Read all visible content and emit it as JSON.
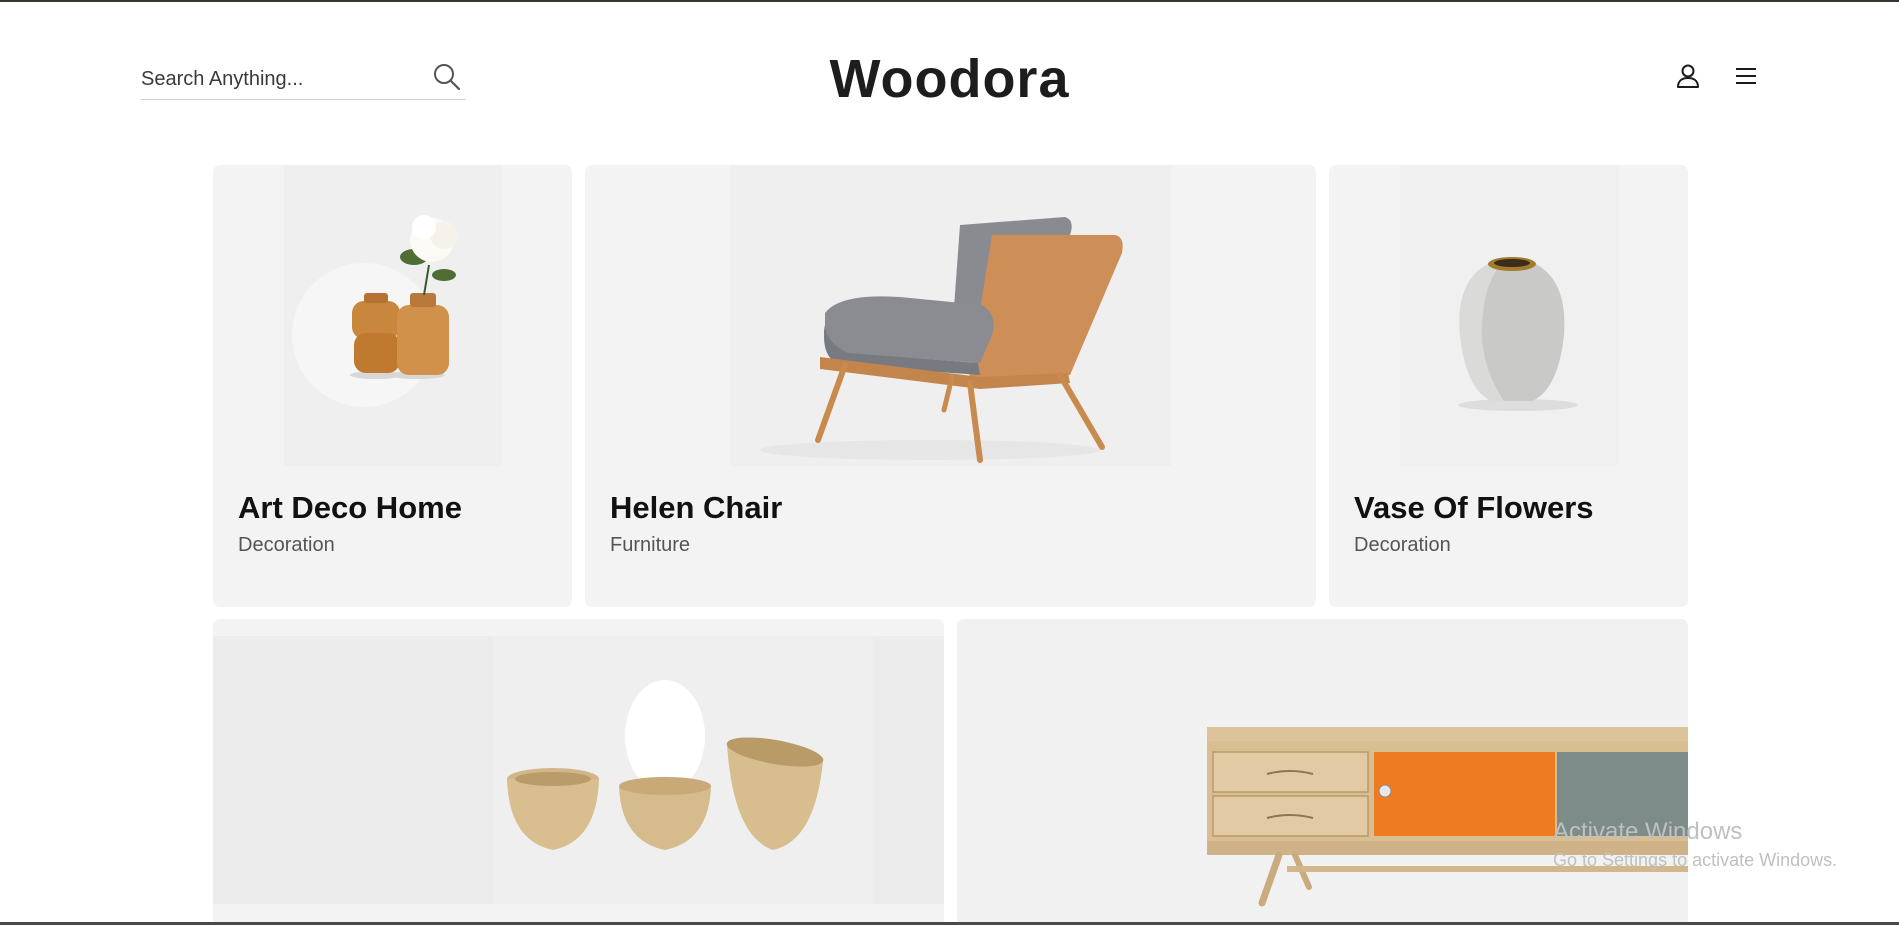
{
  "header": {
    "brand": "Woodora",
    "search_placeholder": "Search Anything...",
    "icons": [
      "search-icon",
      "user-icon",
      "menu-icon"
    ]
  },
  "products": [
    {
      "name": "Art Deco Home",
      "category": "Decoration"
    },
    {
      "name": "Helen Chair",
      "category": "Furniture"
    },
    {
      "name": "Vase Of Flowers",
      "category": "Decoration"
    },
    {
      "name": "",
      "category": ""
    },
    {
      "name": "",
      "category": ""
    }
  ],
  "watermark": {
    "title": "Activate Windows",
    "subtitle": "Go to Settings to activate Windows."
  },
  "colors": {
    "card_bg": "#f3f3f4",
    "brand_text": "#1d1d1d",
    "category_text": "#555555"
  }
}
